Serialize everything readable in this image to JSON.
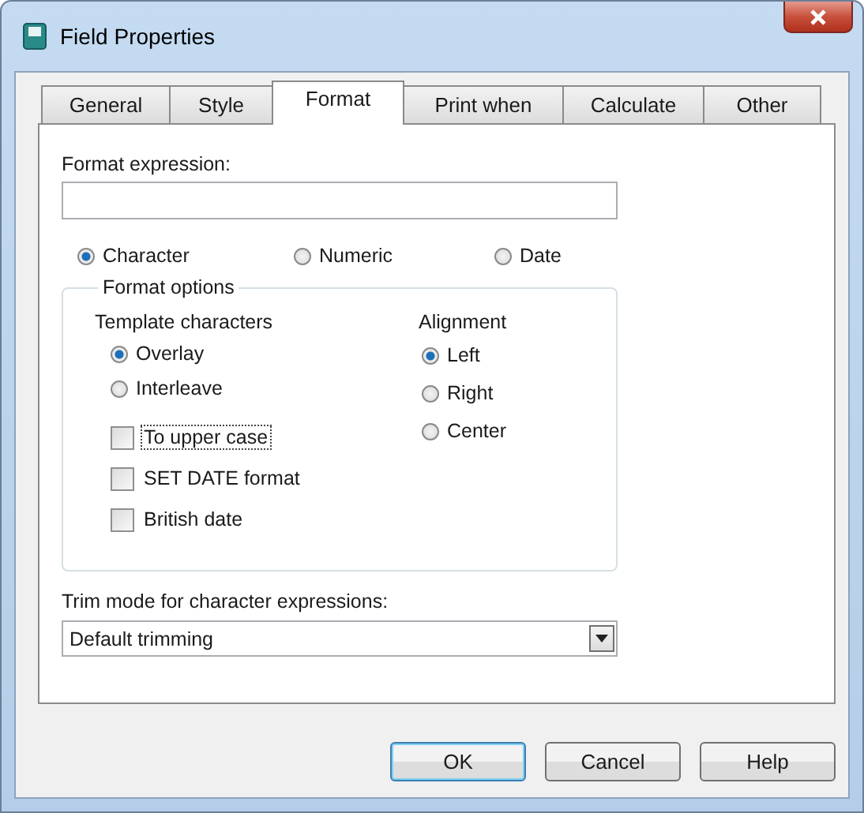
{
  "window": {
    "title": "Field Properties"
  },
  "tabs": [
    {
      "label": "General",
      "selected": false
    },
    {
      "label": "Style",
      "selected": false
    },
    {
      "label": "Format",
      "selected": true
    },
    {
      "label": "Print when",
      "selected": false
    },
    {
      "label": "Calculate",
      "selected": false
    },
    {
      "label": "Other",
      "selected": false
    }
  ],
  "format_expression": {
    "label": "Format expression:"
  },
  "format_types": [
    {
      "label": "Character",
      "selected": true
    },
    {
      "label": "Numeric",
      "selected": false
    },
    {
      "label": "Date",
      "selected": false
    }
  ],
  "format_options": {
    "title": "Format options",
    "template_characters": {
      "label": "Template characters",
      "options": [
        {
          "label": "Overlay",
          "selected": true
        },
        {
          "label": "Interleave",
          "selected": false
        }
      ]
    },
    "checkboxes": [
      {
        "label": "To upper case",
        "checked": false,
        "focused": true
      },
      {
        "label": "SET DATE format",
        "checked": false,
        "focused": false
      },
      {
        "label": "British date",
        "checked": false,
        "focused": false
      }
    ],
    "alignment": {
      "label": "Alignment",
      "options": [
        {
          "label": "Left",
          "selected": true
        },
        {
          "label": "Right",
          "selected": false
        },
        {
          "label": "Center",
          "selected": false
        }
      ]
    }
  },
  "trim_mode": {
    "label": "Trim mode for character expressions:",
    "value": "Default trimming"
  },
  "buttons": [
    {
      "label": "OK",
      "default": true
    },
    {
      "label": "Cancel",
      "default": false
    },
    {
      "label": "Help",
      "default": false
    }
  ]
}
